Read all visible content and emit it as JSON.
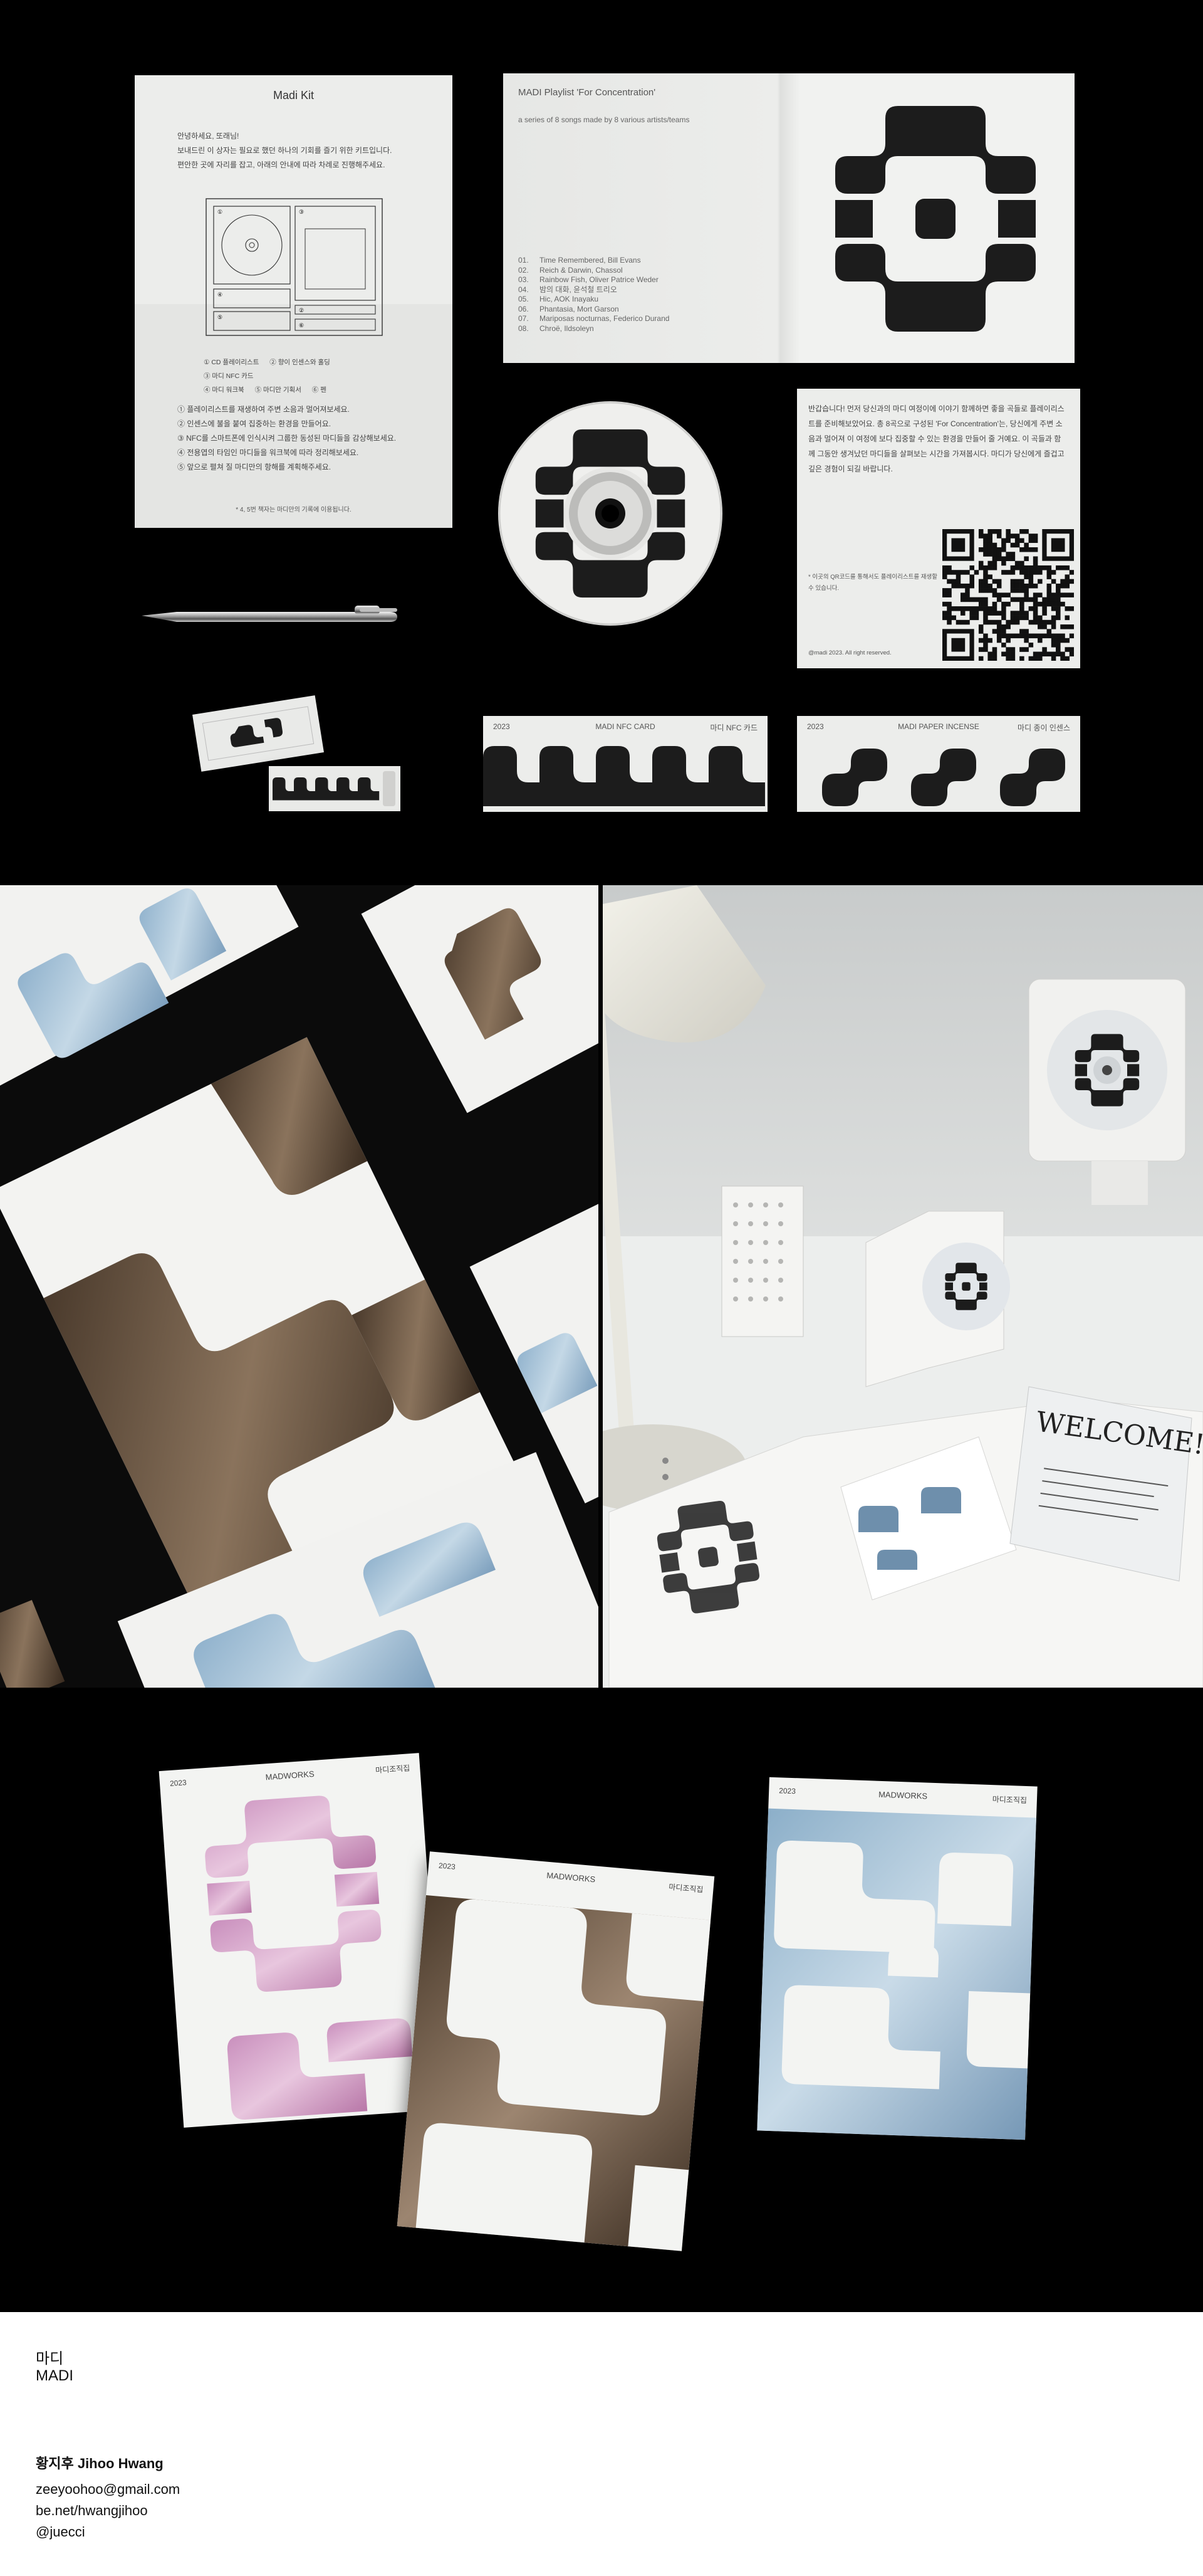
{
  "guide": {
    "title": "Madi Kit",
    "intro": [
      "안녕하세요, 또래님!",
      "보내드린 이 상자는 필요로 했던 하나의 기회를 즐기 위한 키트입니다.",
      "편안한 곳에 자리를 잡고, 아래의 안내에 따라 차례로 진행해주세요."
    ],
    "legend": [
      "① CD 플레이리스트",
      "② 향이 인센스와 홀딩",
      "③ 마디 NFC 카드",
      "④ 마디 워크북",
      "⑤ 마디만 기획서",
      "⑥ 펜"
    ],
    "steps": [
      "① 플레이리스트를 재생하여 주변 소음과 멀어져보세요.",
      "② 인센스에 불을 붙여 집중하는 환경을 만들어요.",
      "③ NFC를 스마트폰에 인식시켜 그룹한 동성된 마디들을 감상해보세요.",
      "④ 전용엽의 타임인 마디들을 워크북에 따라 정리해보세요.",
      "⑤ 앞으로 펼쳐 질 마디만의 항해를 계획해주세요."
    ],
    "note": "* 4, 5번 책자는 마디만의 기록에 이용됩니다."
  },
  "booklet": {
    "title": "MADI Playlist 'For Concentration'",
    "subtitle": "a series of 8 songs made by 8 various artists/teams",
    "tracks": [
      {
        "n": "01.",
        "t": "Time Remembered, Bill Evans"
      },
      {
        "n": "02.",
        "t": "Reich & Darwin, Chassol"
      },
      {
        "n": "03.",
        "t": "Rainbow Fish, Oliver Patrice Weder"
      },
      {
        "n": "04.",
        "t": "밤의 대화, 윤석철 트리오"
      },
      {
        "n": "05.",
        "t": "Hic, AOK Inayaku"
      },
      {
        "n": "06.",
        "t": "Phantasia, Mort Garson"
      },
      {
        "n": "07.",
        "t": "Mariposas nocturnas, Federico Durand"
      },
      {
        "n": "08.",
        "t": "Chroë, Ildsoleyn"
      }
    ]
  },
  "letter": {
    "body": "반갑습니다! 먼저 당신과의 마디 여정이에 이야기 함께하면 좋을 곡들로 플레이리스트를 준비해보았어요. 총 8곡으로 구성된 'For Concentration'는, 당신에게 주변 소음과 멀어져 이 여정에 보다 집중할 수 있는 환경을 만들어 줄 거예요. 이 곡들과 함께 그동안 생겨났던 마디들을 살펴보는 시간을 가져봅시다. 마디가 당신에게 즐겁고 깊은 경험이 되길 바랍니다.",
    "note": "* 이곳의 QR코드를 통해서도 플레이리스트를 재생할 수 있습니다.",
    "copyright": "@madi 2023. All right reserved."
  },
  "cards": {
    "nfc": {
      "year": "2023",
      "name": "MADI NFC CARD",
      "ko": "마디 NFC 카드"
    },
    "incense": {
      "year": "2023",
      "name": "MADI PAPER INCENSE",
      "ko": "마디 종이 인센스"
    }
  },
  "posters": {
    "pink": {
      "year": "2023",
      "brand": "MADWORKS",
      "ko": "마디조직집"
    },
    "brown": {
      "year": "2023",
      "brand": "MADWORKS",
      "ko": "마디조직집"
    },
    "blue": {
      "year": "2023",
      "brand": "MADWORKS",
      "ko": "마디조직집"
    }
  },
  "photo_right": {
    "sign": "WELCOME!"
  },
  "credits": {
    "project_ko": "마디",
    "project_en": "MADI",
    "author": "황지후 Jihoo Hwang",
    "email": "zeeyoohoo@gmail.com",
    "behance": "be.net/hwangjihoo",
    "instagram": "@juecci"
  },
  "colors": {
    "background": "#000000",
    "paper": "#ecedeb",
    "ink": "#1c1c1c",
    "blue": "#a9c4d8",
    "pink": "#d9a4cd",
    "brown": "#7a6655"
  }
}
